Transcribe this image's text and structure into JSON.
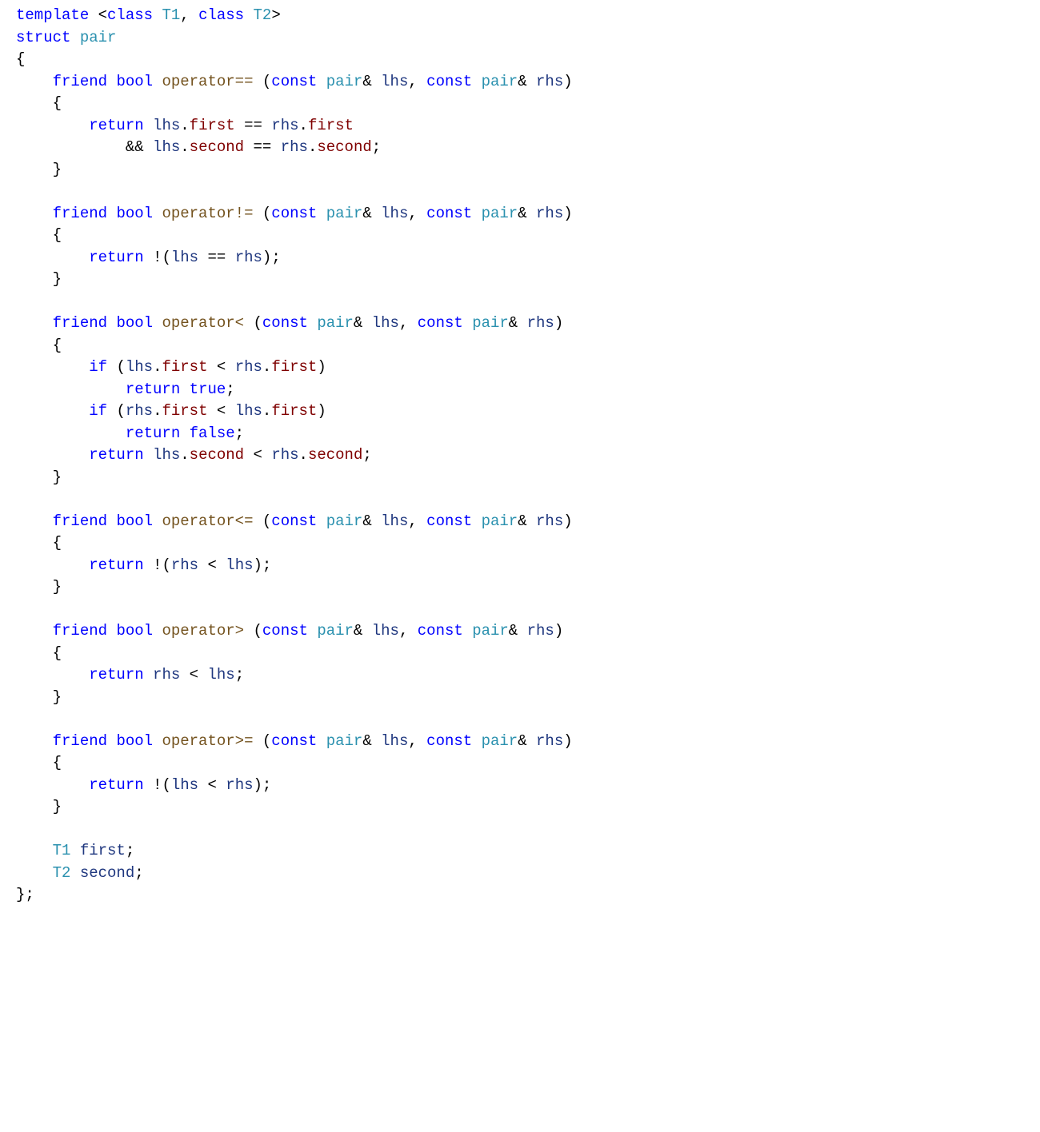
{
  "lang": "cpp",
  "colors": {
    "keyword": "#0000ff",
    "type": "#2b91af",
    "function": "#74531f",
    "variable": "#1f377f",
    "member": "#7f0000",
    "punctuation": "#000000",
    "background": "#ffffff"
  },
  "kw": {
    "template": "template",
    "class": "class",
    "struct": "struct",
    "friend": "friend",
    "bool": "bool",
    "const": "const",
    "if": "if",
    "return": "return",
    "true": "true",
    "false": "false"
  },
  "ty": {
    "T1": "T1",
    "T2": "T2",
    "pair": "pair"
  },
  "fn": {
    "op_eq": "operator",
    "op_ne": "operator",
    "op_lt": "operator",
    "op_le": "operator",
    "op_gt": "operator",
    "op_ge": "operator"
  },
  "sym": {
    "eqeq": "==",
    "ne": "!=",
    "lt": "<",
    "le": "<=",
    "gt": ">",
    "ge": ">="
  },
  "id": {
    "lhs": "lhs",
    "rhs": "rhs",
    "first": "first",
    "second": "second"
  },
  "code_plain": "template <class T1, class T2>\nstruct pair\n{\n    friend bool operator== (const pair& lhs, const pair& rhs)\n    {\n        return lhs.first == rhs.first\n            && lhs.second == rhs.second;\n    }\n\n    friend bool operator!= (const pair& lhs, const pair& rhs)\n    {\n        return !(lhs == rhs);\n    }\n\n    friend bool operator< (const pair& lhs, const pair& rhs)\n    {\n        if (lhs.first < rhs.first)\n            return true;\n        if (rhs.first < lhs.first)\n            return false;\n        return lhs.second < rhs.second;\n    }\n\n    friend bool operator<= (const pair& lhs, const pair& rhs)\n    {\n        return !(rhs < lhs);\n    }\n\n    friend bool operator> (const pair& lhs, const pair& rhs)\n    {\n        return rhs < lhs;\n    }\n\n    friend bool operator>= (const pair& lhs, const pair& rhs)\n    {\n        return !(lhs < rhs);\n    }\n\n    T1 first;\n    T2 second;\n};"
}
